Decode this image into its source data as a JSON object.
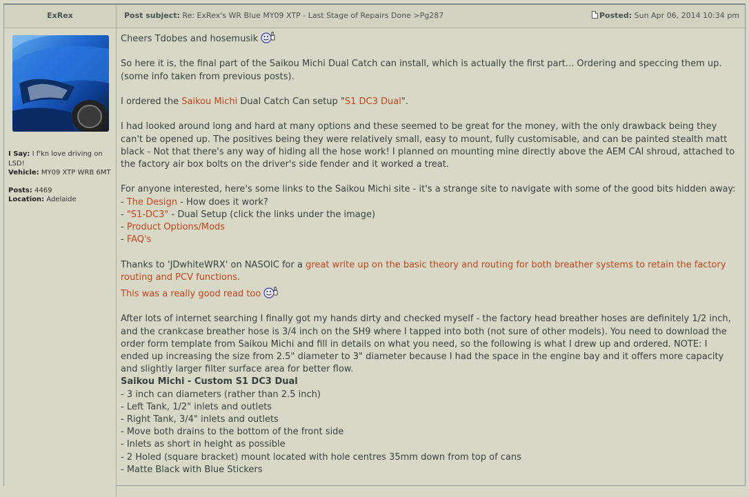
{
  "header": {
    "author": "ExRex",
    "subject_label": "Post subject:",
    "subject_text": "Re: ExRex's WR Blue MY09 XTP - Last Stage of Repairs Done >Pg287",
    "posted_label": "Posted:",
    "posted_date": "Sun Apr 06, 2014 10:34 pm"
  },
  "profile": {
    "isay_label": "I Say:",
    "isay_text": "I f'kn love driving on LSD!",
    "vehicle_label": "Vehicle:",
    "vehicle_text": "MY09 XTP WRB 6MT",
    "posts_label": "Posts:",
    "posts_value": "4469",
    "location_label": "Location:",
    "location_value": "Adelaide"
  },
  "post": {
    "greeting": "Cheers Tdobes and hosemusik",
    "p1": "So here it is, the final part of the Saikou Michi Dual Catch can install, which is actually the first part... Ordering and speccing them up. (some info taken from previous posts).",
    "p2_a": "I ordered the ",
    "p2_link1": "Saikou Michi",
    "p2_b": " Dual Catch Can setup \"",
    "p2_link2": "S1 DC3 Dual",
    "p2_c": "\".",
    "p3": "I had looked around long and hard at many options and these seemed to be great for the money, with the only drawback being they can't be opened up. The positives being they were relatively small, easy to mount, fully customisable, and can be painted stealth matt black - Not that there's any way of hiding all the hose work! I planned on mounting mine directly above the AEM CAI shroud, attached to the factory air box bolts on the driver's side fender and it worked a treat.",
    "p4_intro": "For anyone interested, here's some links to the Saikou Michi site - it's a strange site to navigate with some of the good bits hidden away:",
    "links": [
      {
        "dash": "- ",
        "link": "The Design",
        "rest": " - How does it work?"
      },
      {
        "dash": "- ",
        "link": "\"S1-DC3\"",
        "rest": " - Dual Setup (click the links under the image)"
      },
      {
        "dash": "- ",
        "link": "Product Options/Mods",
        "rest": ""
      },
      {
        "dash": "- ",
        "link": "FAQ's",
        "rest": ""
      }
    ],
    "p5_a": "Thanks to 'JDwhiteWRX' on NASOIC for a ",
    "p5_link": "great write up on the basic theory and routing for both breather systems to retain the factory routing and PCV functions.",
    "p5_b": "This was a really good read too",
    "p6": "After lots of internet searching I finally got my hands dirty and checked myself - the factory head breather hoses are definitely 1/2 inch, and the crankcase breather hose is 3/4 inch on the SH9 where I tapped into both (not sure of other models). You need to download the order form template from Saikou Michi and fill in details on what you need, so the following is what I drew up and ordered. NOTE: I ended up increasing the size from 2.5\" diameter to 3\" diameter because I had the space in the engine bay and it offers more capacity and slightly larger filter surface area for better flow.",
    "spec_title": "Saikou Michi - Custom S1 DC3 Dual",
    "spec_items": [
      "- 3 inch can diameters (rather than 2.5 inch)",
      "- Left Tank, 1/2\" inlets and outlets",
      "- Right Tank, 3/4\" inlets and outlets",
      "- Move both drains to the bottom of the front side",
      "- Inlets as short in height as possible",
      "- 2 Holed (square bracket) mount located with hole centres 35mm down from top of cans",
      "- Matte Black with Blue Stickers"
    ]
  }
}
